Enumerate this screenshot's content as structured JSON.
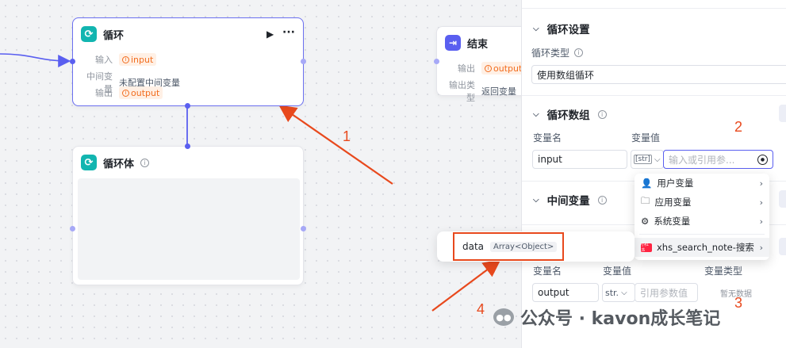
{
  "loop_node": {
    "title": "循环",
    "run_icon": "▶",
    "more_icon": "···",
    "rows": [
      {
        "key": "输入",
        "chip": "input"
      },
      {
        "key": "中间变量",
        "value": "未配置中间变量"
      },
      {
        "key": "输出",
        "chip": "output"
      }
    ]
  },
  "loop_body_node": {
    "title": "循环体"
  },
  "end_node": {
    "title": "结束",
    "rows": [
      {
        "key": "输出",
        "chip": "output"
      },
      {
        "key": "输出类型",
        "value": "返回变量"
      }
    ]
  },
  "panel": {
    "loop_settings": {
      "title": "循环设置",
      "loop_type_label": "循环类型",
      "loop_type_value": "使用数组循环"
    },
    "loop_array": {
      "title": "循环数组",
      "var_name_label": "变量名",
      "var_value_label": "变量值",
      "var_name_value": "input",
      "type_tag": "[str]",
      "ref_placeholder": "输入或引用参..."
    },
    "middle_vars": {
      "title": "中间变量"
    },
    "output": {
      "var_name_label": "变量名",
      "var_value_label": "变量值",
      "var_type_label": "变量类型",
      "var_name_value": "output",
      "type_tag": "str.",
      "ref_placeholder": "引用参数值",
      "empty_text": "暂无数据"
    }
  },
  "dropdown": {
    "items": [
      {
        "label": "用户变量",
        "icon": "user-icon"
      },
      {
        "label": "应用变量",
        "icon": "folder-icon"
      },
      {
        "label": "系统变量",
        "icon": "gear-icon"
      },
      {
        "label": "xhs_search_note-搜索",
        "icon": "xiaohongshu-icon",
        "icon_text": "小红书"
      }
    ]
  },
  "data_popup": {
    "label": "data",
    "type": "Array<Object>"
  },
  "annotations": [
    "1",
    "2",
    "3",
    "4"
  ],
  "watermark": "公众号 · kavon成长笔记",
  "colors": {
    "accent": "#5a5ff0",
    "loop": "#12b5b0",
    "chip": "#f26d1f",
    "annotation": "#e8491d"
  }
}
